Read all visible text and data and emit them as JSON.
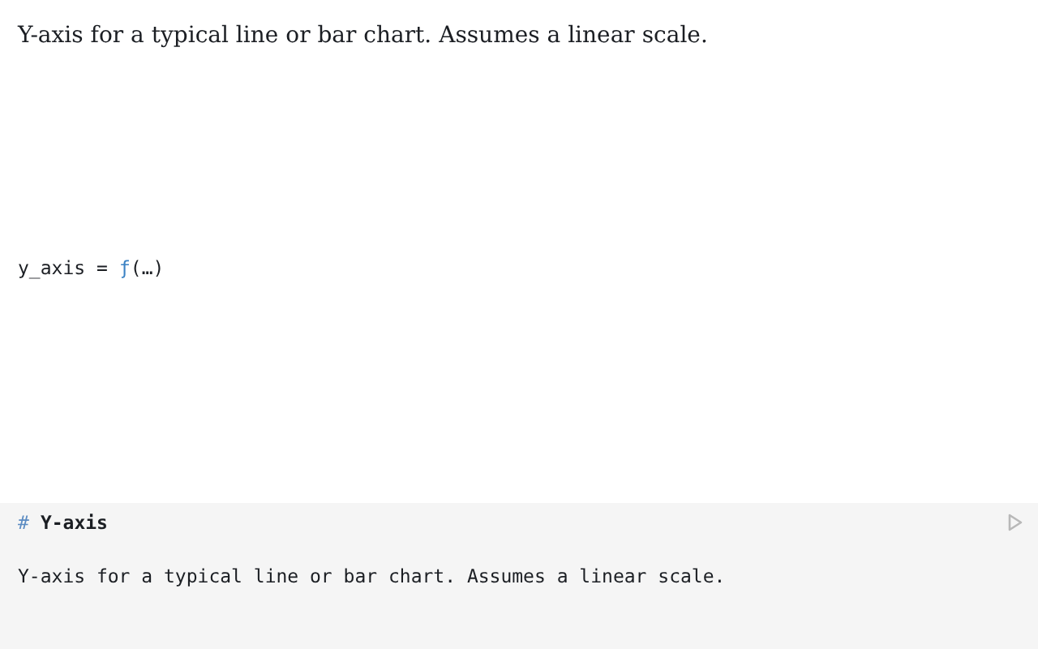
{
  "output": {
    "text": "Y-axis for a typical line or bar chart. Assumes a linear scale."
  },
  "cell_value": {
    "name": "y_axis",
    "operator": "=",
    "function": "ƒ",
    "args": "(…)"
  },
  "editor": {
    "hash": "#",
    "heading": "Y-axis",
    "body": "Y-axis for a typical line or bar chart. Assumes a linear scale."
  }
}
